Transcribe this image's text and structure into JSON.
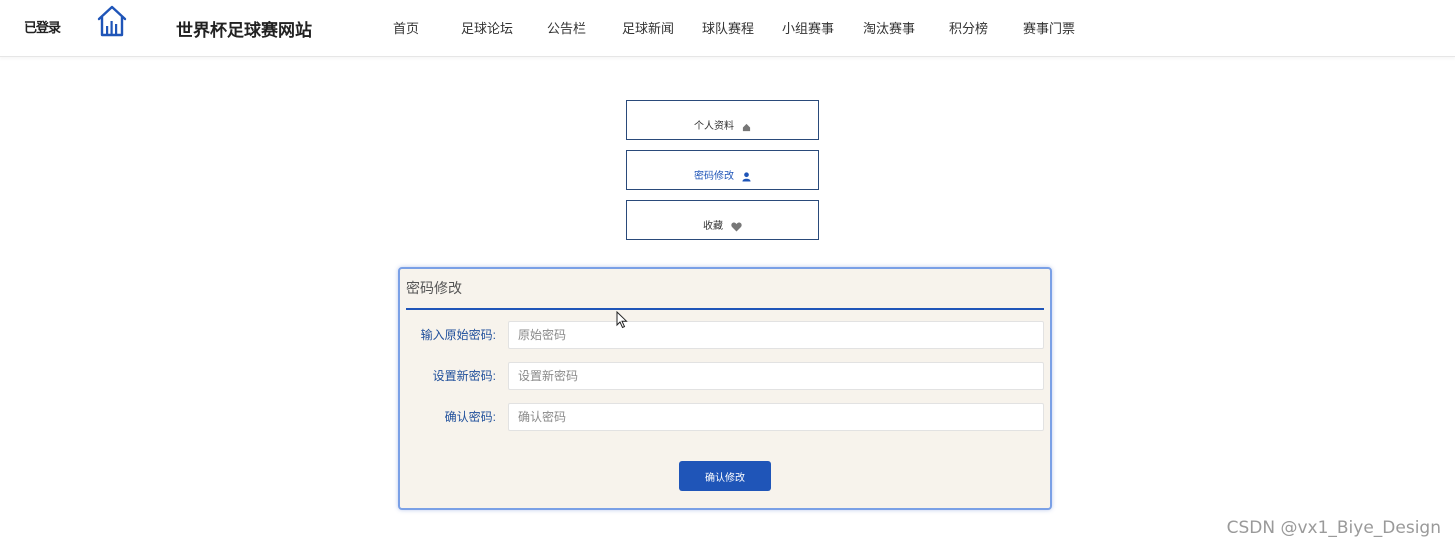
{
  "header": {
    "user_status": "已登录",
    "site_title": "世界杯足球赛网站",
    "nav": [
      "首页",
      "足球论坛",
      "公告栏",
      "足球新闻",
      "球队赛程",
      "小组赛事",
      "淘汰赛事",
      "积分榜",
      "赛事门票"
    ]
  },
  "side_menu": {
    "profile": "个人资料",
    "password": "密码修改",
    "favorites": "收藏"
  },
  "form": {
    "title": "密码修改",
    "fields": [
      {
        "label": "输入原始密码:",
        "placeholder": "原始密码",
        "value": ""
      },
      {
        "label": "设置新密码:",
        "placeholder": "设置新密码",
        "value": ""
      },
      {
        "label": "确认密码:",
        "placeholder": "确认密码",
        "value": ""
      }
    ],
    "submit_label": "确认修改"
  },
  "watermark": "CSDN @vx1_Biye_Design",
  "colors": {
    "accent": "#1f55b8",
    "panel_bg": "#f7f3ec",
    "panel_border": "#7aa0e6"
  }
}
